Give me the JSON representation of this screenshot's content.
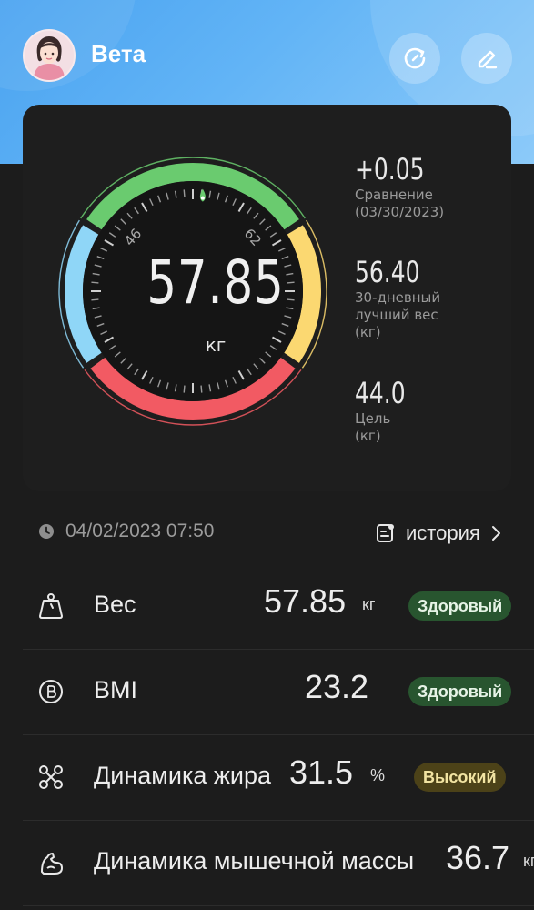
{
  "header": {
    "username": "Вета",
    "refresh_icon": "refresh-icon",
    "edit_icon": "edit-icon"
  },
  "gauge": {
    "value": "57.85",
    "unit": "кг",
    "tick_low": "46",
    "tick_high": "62",
    "colors": {
      "blue": "#8fd6f7",
      "green": "#6acb6f",
      "yellow": "#fbd871",
      "red": "#f25a63"
    }
  },
  "stats": [
    {
      "value": "+0.05",
      "label": [
        "Сравнение",
        "(03/30/2023)"
      ]
    },
    {
      "value": "56.40",
      "label": [
        "30-дневный",
        "лучший вес",
        "(кг)"
      ]
    },
    {
      "value": "44.0",
      "label": [
        "Цель",
        "(кг)"
      ]
    }
  ],
  "record": {
    "datetime": "04/02/2023 07:50",
    "history_label": "история"
  },
  "metrics": [
    {
      "name": "Вес",
      "value": "57.85",
      "unit": "кг",
      "status": "Здоровый",
      "icon": "weight-icon"
    },
    {
      "name": "BMI",
      "value": "23.2",
      "unit": "",
      "status": "Здоровый",
      "icon": "bmi-icon"
    },
    {
      "name": "Динамика жира",
      "value": "31.5",
      "unit": "%",
      "status": "Высокий",
      "icon": "body-fat-icon"
    },
    {
      "name": "Динамика мышечной массы",
      "value": "36.7",
      "unit": "кг",
      "status": "",
      "icon": "muscle-icon"
    }
  ]
}
